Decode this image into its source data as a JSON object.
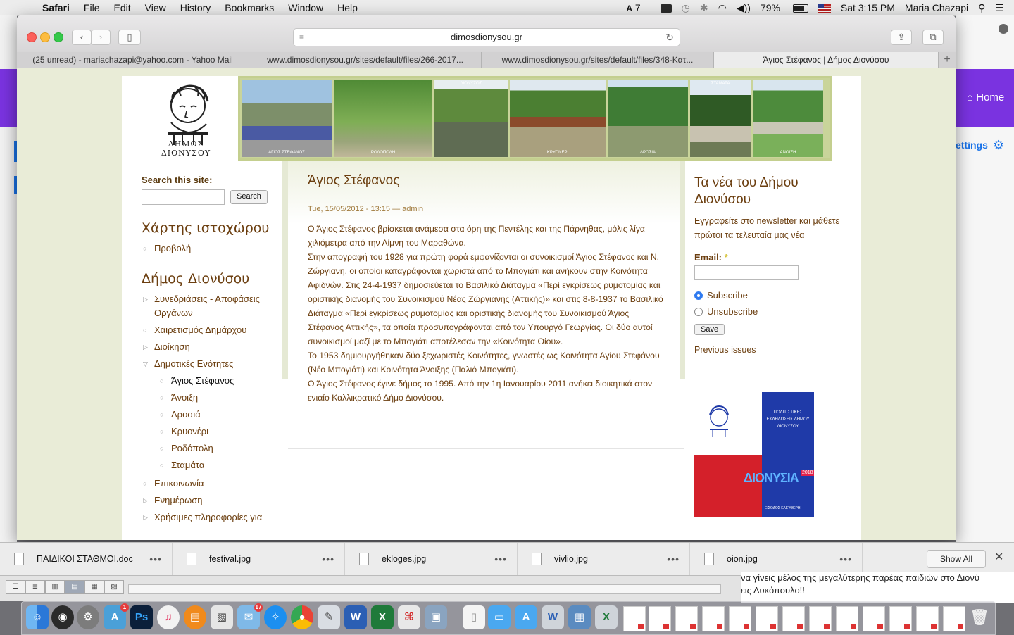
{
  "menubar": {
    "app": "Safari",
    "items": [
      "File",
      "Edit",
      "View",
      "History",
      "Bookmarks",
      "Window",
      "Help"
    ],
    "status": {
      "adobe": "7",
      "battery": "79%",
      "time": "Sat 3:15 PM",
      "user": "Maria Chazapi"
    }
  },
  "background": {
    "home": "Home",
    "settings": "ettings"
  },
  "safari": {
    "url": "dimosdionysou.gr",
    "tabs": [
      "(25 unread) - mariachazapi@yahoo.com - Yahoo Mail",
      "www.dimosdionysou.gr/sites/default/files/266-2017...",
      "www.dimosdionysou.gr/sites/default/files/348-Κατ...",
      "Άγιος Στέφανος | Δήμος Διονύσου"
    ],
    "new_tab": "+"
  },
  "site": {
    "logo_text": "ΔΗΜΟΣ ΔΙΟΝΥΣΟΥ",
    "banner_captions": [
      "ΑΓΙΟΣ ΣΤΕΦΑΝΟΣ",
      "ΡΟΔΟΠΟΛΗ",
      "ΔΙΟΝΥΣΟΣ",
      "ΚΡΥΟΝΕΡΙ",
      "ΔΡΟΣΙΑ",
      "ΣΤΑΜΑΤΑ",
      "ΑΝΟΙΞΗ"
    ],
    "search": {
      "label": "Search this site:",
      "button": "Search",
      "value": ""
    },
    "sitemap": {
      "title": "Χάρτης ιστοχώρου",
      "items": [
        "Προβολή"
      ]
    },
    "dimos": {
      "title": "Δήμος Διονύσου",
      "items": [
        "Συνεδριάσεις - Αποφάσεις Οργάνων",
        "Χαιρετισμός Δημάρχου",
        "Διοίκηση",
        "Δημοτικές Ενότητες",
        "Άγιος Στέφανος",
        "Άνοιξη",
        "Δροσιά",
        "Κρυονέρι",
        "Ροδόπολη",
        "Σταμάτα",
        "Επικοινωνία",
        "Ενημέρωση",
        "Χρήσιμες πληροφορίες για"
      ]
    },
    "article": {
      "title": "Άγιος Στέφανος",
      "meta": "Tue, 15/05/2012 - 13:15 — admin",
      "paragraphs": [
        "Ο Άγιος Στέφανος βρίσκεται ανάμεσα στα όρη της Πεντέλης και της Πάρνηθας, μόλις λίγα χιλιόμετρα από την Λίμνη του Μαραθώνα.",
        "Στην απογραφή του 1928 για πρώτη φορά εμφανίζονται οι συνοικισμοί Άγιος Στέφανος και Ν. Ζώργιανη, οι οποίοι καταγράφονται χωριστά από το Μπογιάτι και ανήκουν στην Κοινότητα Αφιδνών. Στις 24-4-1937 δημοσιεύεται το Βασιλικό Διάταγμα «Περί εγκρίσεως ρυμοτομίας και οριστικής διανομής του Συνοικισμού Νέας Ζώργιανης (Αττικής)» και στις 8-8-1937 το Βασιλικό Διάταγμα «Περί εγκρίσεως ρυμοτομίας και οριστικής διανομής του Συνοικισμού Άγιος Στέφανος Αττικής», τα οποία προσυπογράφονται από τον Υπουργό Γεωργίας. Οι δύο αυτοί συνοικισμοί μαζί με το Μπογιάτι αποτέλεσαν την «Κοινότητα Οίου».",
        "Το 1953 δημιουργήθηκαν δύο ξεχωριστές Κοινότητες, γνωστές ως Κοινότητα Αγίου Στεφάνου (Νέο Μπογιάτι) και Κοινότητα Άνοιξης (Παλιό Μπογιάτι).",
        "Ο Άγιος Στέφανος έγινε δήμος το 1995. Από την 1η Ιανουαρίου 2011 ανήκει διοικητικά στον ενιαίο Καλλικρατικό Δήμο Διονύσου."
      ]
    },
    "newsletter": {
      "title": "Τα νέα του Δήμου Διονύσου",
      "description": "Εγγραφείτε στο newsletter και μάθετε πρώτοι τα τελευταία μας νέα",
      "email_label": "Email:",
      "required_mark": "*",
      "email_value": "",
      "subscribe": "Subscribe",
      "unsubscribe": "Unsubscribe",
      "selected": "subscribe",
      "save": "Save",
      "previous": "Previous issues"
    },
    "poster": {
      "lines": "ΠΟΛΙΤΙΣΤΙΚΕΣ ΕΚΔΗΛΩΣΕΙΣ ΔΗΜΟΥ ΔΙΟΝΥΣΟΥ",
      "title": "ΔΙΟΝΥΣΙΑ",
      "year": "2018",
      "entry": "ΕΙΣΟΔΟΣ ΕΛΕΥΘΕΡΗ"
    }
  },
  "downloads": {
    "items": [
      "ΠΑΙΔΙΚΟΙ ΣΤΑΘΜΟΙ.doc",
      "festival.jpg",
      "ekloges.jpg",
      "vivlio.jpg",
      "oion.jpg"
    ],
    "more": "•••",
    "show_all": "Show All",
    "close": "✕"
  },
  "finder": {
    "background_text_1": "να γίνεις μέλος της μεγαλύτερης παρέας παιδιών στο Διονύ",
    "background_text_2": "εις Λυκόπουλο!!"
  },
  "dock": {
    "badges": {
      "app_store": "1",
      "mail": "17"
    },
    "ps": "Ps",
    "word": "W",
    "excel": "X"
  },
  "colors": {
    "brand_brown": "#6b3e0f",
    "page_bg": "#e9ecd7",
    "banner_green": "#c9d49a",
    "radio_blue": "#2f7bf0"
  }
}
